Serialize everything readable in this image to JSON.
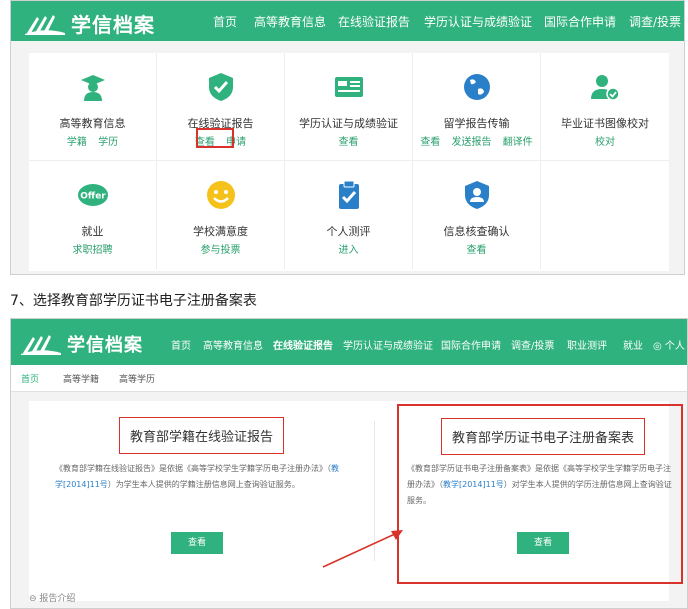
{
  "colors": {
    "brand_green": "#2fb27d",
    "highlight_red": "#d9322a",
    "link_green": "#2aa06e"
  },
  "shot1": {
    "logo_text": "学信档案",
    "nav": [
      "首页",
      "高等教育信息",
      "在线验证报告",
      "学历认证与成绩验证",
      "国际合作申请",
      "调查/投票"
    ],
    "cells": [
      {
        "title": "高等教育信息",
        "links": [
          "学籍",
          "学历"
        ],
        "icon": "graduate-icon"
      },
      {
        "title": "在线验证报告",
        "links": [
          "查看",
          "申请"
        ],
        "icon": "shield-check-icon"
      },
      {
        "title": "学历认证与成绩验证",
        "links": [
          "查看"
        ],
        "icon": "id-card-icon"
      },
      {
        "title": "留学报告传输",
        "links": [
          "查看",
          "发送报告",
          "翻译件"
        ],
        "icon": "globe-icon"
      },
      {
        "title": "毕业证书图像校对",
        "links": [
          "校对"
        ],
        "icon": "user-check-icon"
      },
      {
        "title": "就业",
        "links": [
          "求职招聘"
        ],
        "icon": "offer-icon"
      },
      {
        "title": "学校满意度",
        "links": [
          "参与投票"
        ],
        "icon": "smile-icon"
      },
      {
        "title": "个人测评",
        "links": [
          "进入"
        ],
        "icon": "clipboard-check-icon"
      },
      {
        "title": "信息核查确认",
        "links": [
          "查看"
        ],
        "icon": "person-shield-icon"
      }
    ]
  },
  "caption": "7、选择教育部学历证书电子注册备案表",
  "shot2": {
    "logo_text": "学信档案",
    "nav": [
      "首页",
      "高等教育信息",
      "在线验证报告",
      "学历认证与成绩验证",
      "国际合作申请",
      "调查/投票",
      "职业测评",
      "就业",
      "个人"
    ],
    "subnav": [
      "首页",
      "高等学籍",
      "高等学历"
    ],
    "left_card": {
      "title": "教育部学籍在线验证报告",
      "desc_a": "《教育部学籍在线验证报告》是依据《高等学校学生学籍学历电子注册办法》（",
      "desc_hl": "教学[2014]11号",
      "desc_b": "）为学生本人提供的学籍注册信息网上查询验证服务。",
      "button": "查看"
    },
    "right_card": {
      "title": "教育部学历证书电子注册备案表",
      "desc_a": "《教育部学历证书电子注册备案表》是依据《高等学校学生学籍学历电子注册办法》（",
      "desc_hl": "教学[2014]11号",
      "desc_b": "）对学生本人提供的学历注册信息网上查询验证服务。",
      "button": "查看"
    },
    "report_intro": "报告介绍"
  }
}
